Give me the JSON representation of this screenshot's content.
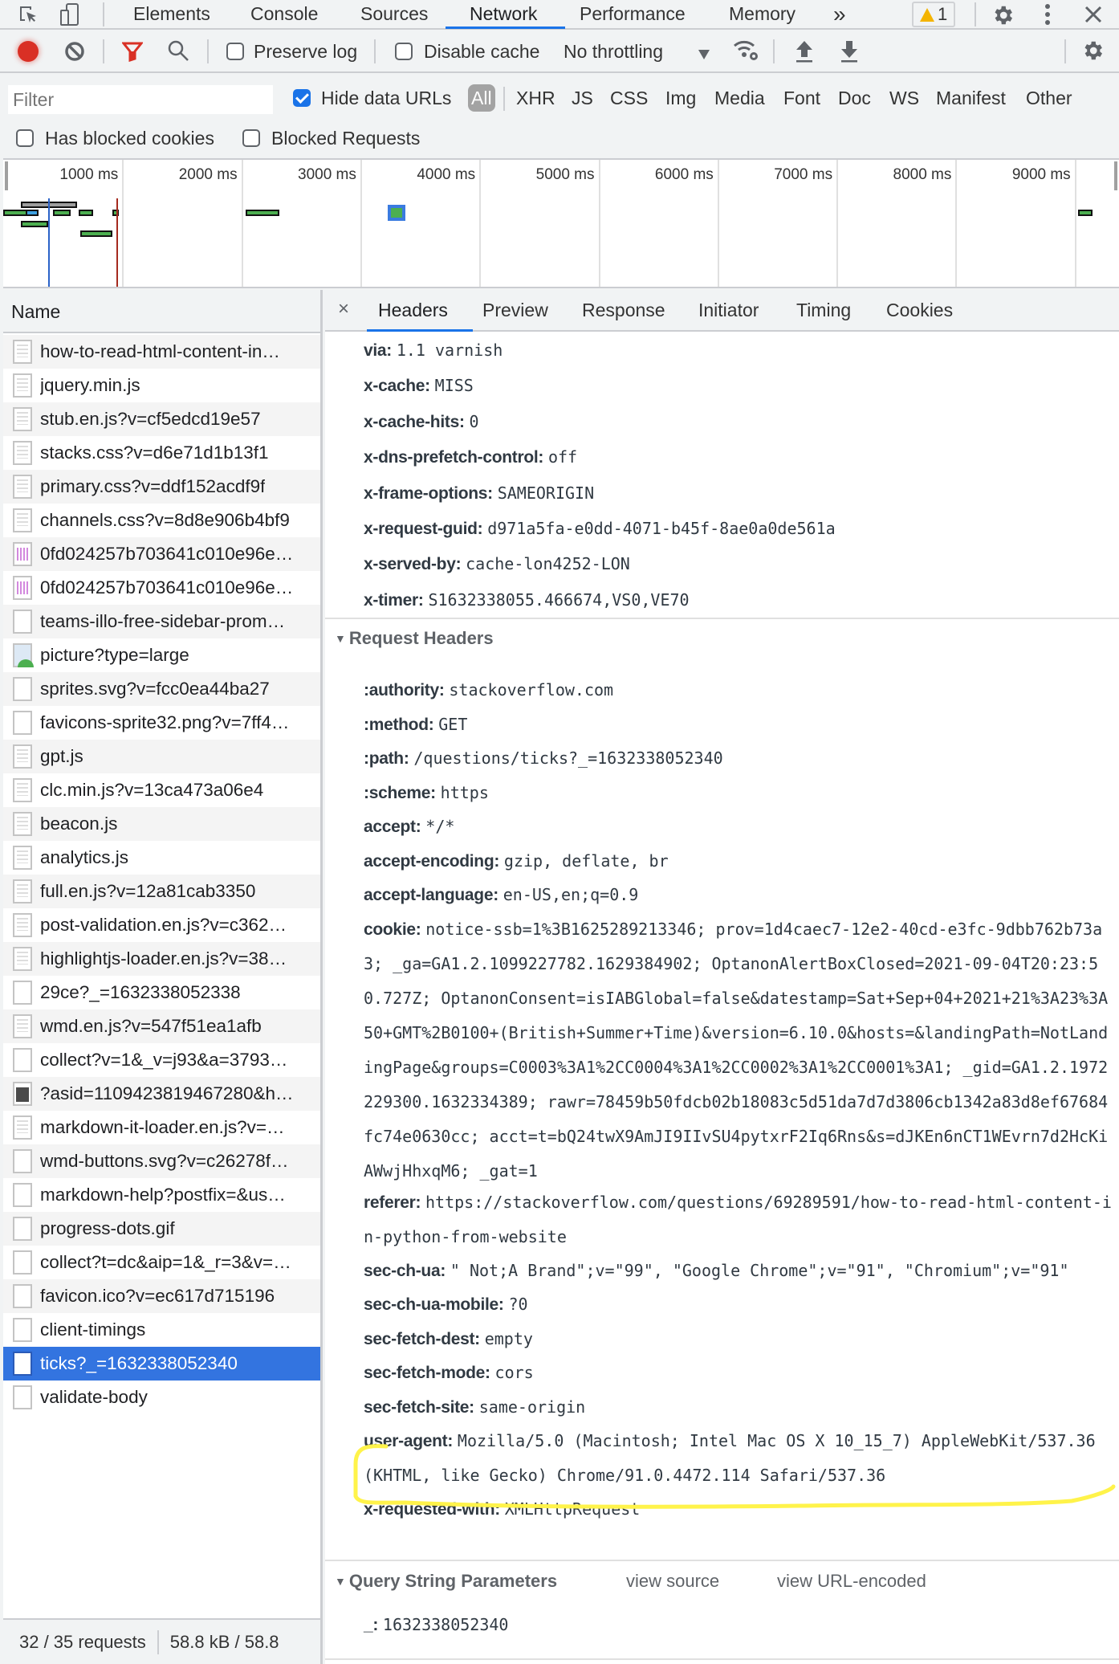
{
  "top_tabs": {
    "inspect_icon": "inspect-element-icon",
    "device_icon": "device-toolbar-icon",
    "items": [
      "Elements",
      "Console",
      "Sources",
      "Network",
      "Performance",
      "Memory"
    ],
    "active": "Network",
    "more": "»",
    "warning_count": "1",
    "settings_icon": "gear-icon",
    "menu_icon": "kebab-menu-icon",
    "close_icon": "close-icon"
  },
  "toolbar": {
    "preserve_log": "Preserve log",
    "preserve_log_checked": false,
    "disable_cache": "Disable cache",
    "disable_cache_checked": false,
    "throttling": "No throttling"
  },
  "filter": {
    "placeholder": "Filter",
    "hide_data_urls": "Hide data URLs",
    "hide_data_urls_checked": true,
    "types": [
      "All",
      "XHR",
      "JS",
      "CSS",
      "Img",
      "Media",
      "Font",
      "Doc",
      "WS",
      "Manifest",
      "Other"
    ],
    "active_type": "All",
    "has_blocked_cookies": "Has blocked cookies",
    "blocked_requests": "Blocked Requests"
  },
  "timeline": {
    "ticks": [
      "1000 ms",
      "2000 ms",
      "3000 ms",
      "4000 ms",
      "5000 ms",
      "6000 ms",
      "7000 ms",
      "8000 ms",
      "9000 ms"
    ],
    "dom_content_loaded_ms": 380,
    "load_ms": 950
  },
  "requests": {
    "header": "Name",
    "items": [
      {
        "name": "how-to-read-html-content-in…",
        "icon": "doc"
      },
      {
        "name": "jquery.min.js",
        "icon": "doc"
      },
      {
        "name": "stub.en.js?v=cf5edcd19e57",
        "icon": "doc"
      },
      {
        "name": "stacks.css?v=d6e71d1b13f1",
        "icon": "doc"
      },
      {
        "name": "primary.css?v=ddf152acdf9f",
        "icon": "doc"
      },
      {
        "name": "channels.css?v=8d8e906b4bf9",
        "icon": "doc"
      },
      {
        "name": "0fd024257b703641c010e96e…",
        "icon": "img"
      },
      {
        "name": "0fd024257b703641c010e96e…",
        "icon": "img"
      },
      {
        "name": "teams-illo-free-sidebar-prom…",
        "icon": "blank"
      },
      {
        "name": "picture?type=large",
        "icon": "pic"
      },
      {
        "name": "sprites.svg?v=fcc0ea44ba27",
        "icon": "blank"
      },
      {
        "name": "favicons-sprite32.png?v=7ff4…",
        "icon": "blank"
      },
      {
        "name": "gpt.js",
        "icon": "doc"
      },
      {
        "name": "clc.min.js?v=13ca473a06e4",
        "icon": "doc"
      },
      {
        "name": "beacon.js",
        "icon": "doc"
      },
      {
        "name": "analytics.js",
        "icon": "doc"
      },
      {
        "name": "full.en.js?v=12a81cab3350",
        "icon": "doc"
      },
      {
        "name": "post-validation.en.js?v=c362…",
        "icon": "doc"
      },
      {
        "name": "highlightjs-loader.en.js?v=38…",
        "icon": "doc"
      },
      {
        "name": "29ce?_=1632338052338",
        "icon": "blank"
      },
      {
        "name": "wmd.en.js?v=547f51ea1afb",
        "icon": "doc"
      },
      {
        "name": "collect?v=1&_v=j93&a=3793…",
        "icon": "blank"
      },
      {
        "name": "?asid=1109423819467280&h…",
        "icon": "photo"
      },
      {
        "name": "markdown-it-loader.en.js?v=…",
        "icon": "doc"
      },
      {
        "name": "wmd-buttons.svg?v=c26278f…",
        "icon": "blank"
      },
      {
        "name": "markdown-help?postfix=&us…",
        "icon": "blank"
      },
      {
        "name": "progress-dots.gif",
        "icon": "blank"
      },
      {
        "name": "collect?t=dc&aip=1&_r=3&v=…",
        "icon": "blank"
      },
      {
        "name": "favicon.ico?v=ec617d715196",
        "icon": "blank"
      },
      {
        "name": "client-timings",
        "icon": "blank"
      },
      {
        "name": "ticks?_=1632338052340",
        "icon": "blank",
        "selected": true
      },
      {
        "name": "validate-body",
        "icon": "blank"
      }
    ],
    "status_requests": "32 / 35 requests",
    "status_size": "58.8 kB / 58.8"
  },
  "detail": {
    "close": "×",
    "tabs": [
      "Headers",
      "Preview",
      "Response",
      "Initiator",
      "Timing",
      "Cookies"
    ],
    "active_tab": "Headers",
    "response_headers_tail": [
      {
        "k": "via:",
        "v": "1.1 varnish"
      },
      {
        "k": "x-cache:",
        "v": "MISS"
      },
      {
        "k": "x-cache-hits:",
        "v": "0"
      },
      {
        "k": "x-dns-prefetch-control:",
        "v": "off"
      },
      {
        "k": "x-frame-options:",
        "v": "SAMEORIGIN"
      },
      {
        "k": "x-request-guid:",
        "v": "d971a5fa-e0dd-4071-b45f-8ae0a0de561a"
      },
      {
        "k": "x-served-by:",
        "v": "cache-lon4252-LON"
      },
      {
        "k": "x-timer:",
        "v": "S1632338055.466674,VS0,VE70"
      }
    ],
    "request_headers_title": "Request Headers",
    "request_headers": [
      {
        "k": ":authority:",
        "v": "stackoverflow.com"
      },
      {
        "k": ":method:",
        "v": "GET"
      },
      {
        "k": ":path:",
        "v": "/questions/ticks?_=1632338052340"
      },
      {
        "k": ":scheme:",
        "v": "https"
      },
      {
        "k": "accept:",
        "v": "*/*"
      },
      {
        "k": "accept-encoding:",
        "v": "gzip, deflate, br"
      },
      {
        "k": "accept-language:",
        "v": "en-US,en;q=0.9"
      },
      {
        "k": "cookie:",
        "v": "notice-ssb=1%3B1625289213346; prov=1d4caec7-12e2-40cd-e3fc-9dbb762b73a3; _ga=GA1.2.1099227782.1629384902; OptanonAlertBoxClosed=2021-09-04T20:23:50.727Z; OptanonConsent=isIABGlobal=false&datestamp=Sat+Sep+04+2021+21%3A23%3A50+GMT%2B0100+(British+Summer+Time)&version=6.10.0&hosts=&landingPath=NotLandingPage&groups=C0003%3A1%2CC0004%3A1%2CC0002%3A1%2CC0001%3A1; _gid=GA1.2.1972229300.1632334389; rawr=78459b50fdcb02b18083c5d51da7d7d3806cb1342a83d8ef67684fc74e0630cc; acct=t=bQ24twX9AmJI9IIvSU4pytxrF2Iq6Rns&s=dJKEn6nCT1WEvrn7d2HcKiAWwjHhxqM6; _gat=1"
      },
      {
        "k": "referer:",
        "v": "https://stackoverflow.com/questions/69289591/how-to-read-html-content-in-python-from-website"
      },
      {
        "k": "sec-ch-ua:",
        "v": "\" Not;A Brand\";v=\"99\", \"Google Chrome\";v=\"91\", \"Chromium\";v=\"91\""
      },
      {
        "k": "sec-ch-ua-mobile:",
        "v": "?0"
      },
      {
        "k": "sec-fetch-dest:",
        "v": "empty"
      },
      {
        "k": "sec-fetch-mode:",
        "v": "cors"
      },
      {
        "k": "sec-fetch-site:",
        "v": "same-origin"
      },
      {
        "k": "user-agent:",
        "v": "Mozilla/5.0 (Macintosh; Intel Mac OS X 10_15_7) AppleWebKit/537.36 (KHTML, like Gecko) Chrome/91.0.4472.114 Safari/537.36"
      },
      {
        "k": "x-requested-with:",
        "v": "XMLHttpRequest"
      }
    ],
    "query_title": "Query String Parameters",
    "view_source": "view source",
    "view_url_encoded": "view URL-encoded",
    "query_params": [
      {
        "k": "_:",
        "v": "1632338052340"
      }
    ]
  },
  "colors": {
    "accent": "#1a73e8",
    "selected_row": "#3374e0",
    "record": "#d93025",
    "filter_icon": "#d93025",
    "highlight_annotation": "#fff34a",
    "dcl_line": "#2b63c9",
    "load_line": "#a52a1f"
  }
}
